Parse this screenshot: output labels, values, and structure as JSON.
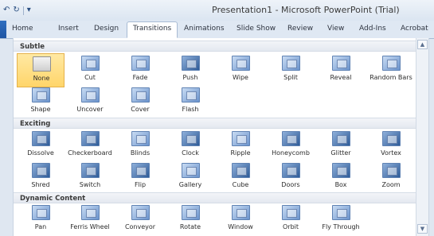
{
  "qat": {
    "undo": "↶",
    "redo": "↻",
    "customize": "▾"
  },
  "window": {
    "title": "Presentation1 - Microsoft PowerPoint (Trial)"
  },
  "tabs": [
    {
      "label": "Home"
    },
    {
      "label": "Insert"
    },
    {
      "label": "Design"
    },
    {
      "label": "Transitions"
    },
    {
      "label": "Animations"
    },
    {
      "label": "Slide Show"
    },
    {
      "label": "Review"
    },
    {
      "label": "View"
    },
    {
      "label": "Add-Ins"
    },
    {
      "label": "Acrobat"
    }
  ],
  "sections": [
    {
      "title": "Subtle"
    },
    {
      "title": "Exciting"
    },
    {
      "title": "Dynamic Content"
    }
  ],
  "subtle": [
    {
      "label": "None",
      "icon": "none-icon"
    },
    {
      "label": "Cut",
      "icon": "cut-icon"
    },
    {
      "label": "Fade",
      "icon": "fade-icon"
    },
    {
      "label": "Push",
      "icon": "push-icon"
    },
    {
      "label": "Wipe",
      "icon": "wipe-icon"
    },
    {
      "label": "Split",
      "icon": "split-icon"
    },
    {
      "label": "Reveal",
      "icon": "reveal-icon"
    },
    {
      "label": "Random Bars",
      "icon": "random-bars-icon"
    },
    {
      "label": "Shape",
      "icon": "shape-icon"
    },
    {
      "label": "Uncover",
      "icon": "uncover-icon"
    },
    {
      "label": "Cover",
      "icon": "cover-icon"
    },
    {
      "label": "Flash",
      "icon": "flash-icon"
    }
  ],
  "exciting": [
    {
      "label": "Dissolve",
      "icon": "dissolve-icon"
    },
    {
      "label": "Checkerboard",
      "icon": "checkerboard-icon"
    },
    {
      "label": "Blinds",
      "icon": "blinds-icon"
    },
    {
      "label": "Clock",
      "icon": "clock-icon"
    },
    {
      "label": "Ripple",
      "icon": "ripple-icon"
    },
    {
      "label": "Honeycomb",
      "icon": "honeycomb-icon"
    },
    {
      "label": "Glitter",
      "icon": "glitter-icon"
    },
    {
      "label": "Vortex",
      "icon": "vortex-icon"
    },
    {
      "label": "Shred",
      "icon": "shred-icon"
    },
    {
      "label": "Switch",
      "icon": "switch-icon"
    },
    {
      "label": "Flip",
      "icon": "flip-icon"
    },
    {
      "label": "Gallery",
      "icon": "gallery-icon"
    },
    {
      "label": "Cube",
      "icon": "cube-icon"
    },
    {
      "label": "Doors",
      "icon": "doors-icon"
    },
    {
      "label": "Box",
      "icon": "box-icon"
    },
    {
      "label": "Zoom",
      "icon": "zoom-icon"
    }
  ],
  "dynamic": [
    {
      "label": "Pan",
      "icon": "pan-icon"
    },
    {
      "label": "Ferris Wheel",
      "icon": "ferris-wheel-icon"
    },
    {
      "label": "Conveyor",
      "icon": "conveyor-icon"
    },
    {
      "label": "Rotate",
      "icon": "rotate-icon"
    },
    {
      "label": "Window",
      "icon": "window-icon"
    },
    {
      "label": "Orbit",
      "icon": "orbit-icon"
    },
    {
      "label": "Fly Through",
      "icon": "fly-through-icon"
    }
  ],
  "selected": "None",
  "scroll": {
    "up": "▲",
    "down": "▼"
  }
}
